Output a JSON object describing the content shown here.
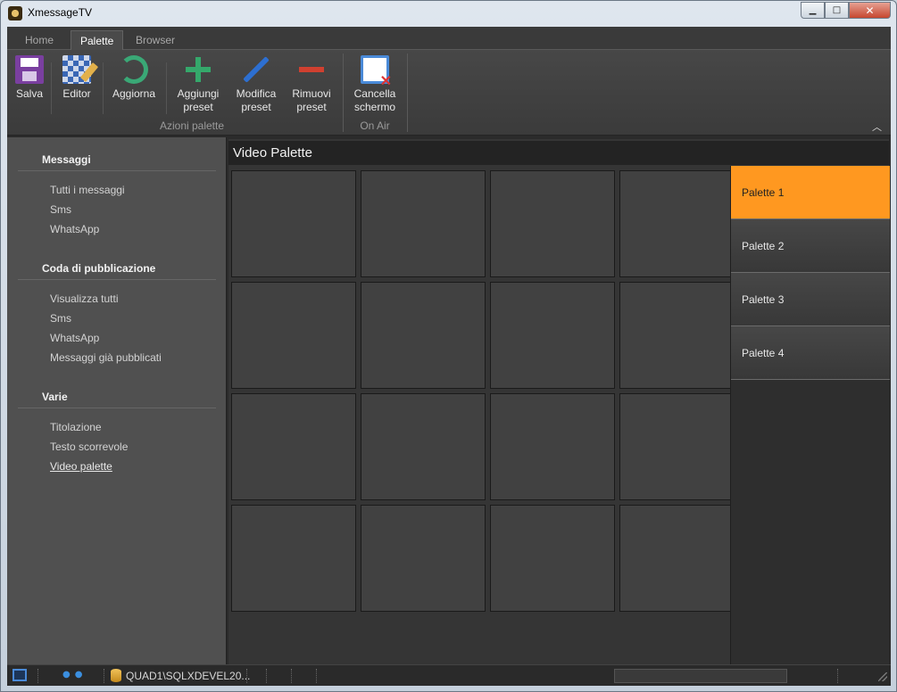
{
  "window": {
    "title": "XmessageTV",
    "minimize_icon": "minimize-icon",
    "maximize_icon": "maximize-icon",
    "close_label": "✕"
  },
  "ribbon": {
    "tabs": [
      {
        "label": "Home",
        "active": false
      },
      {
        "label": "Palette",
        "active": true
      },
      {
        "label": "Browser",
        "active": false
      }
    ],
    "buttons": {
      "save": {
        "label": "Salva",
        "icon": "save-icon"
      },
      "editor": {
        "label": "Editor",
        "icon": "editor-icon"
      },
      "refresh": {
        "label": "Aggiorna",
        "icon": "refresh-icon"
      },
      "add_preset": {
        "label_1": "Aggiungi",
        "label_2": "preset",
        "icon": "plus-icon"
      },
      "edit_preset": {
        "label_1": "Modifica",
        "label_2": "preset",
        "icon": "pencil-icon"
      },
      "remove_preset": {
        "label_1": "Rimuovi",
        "label_2": "preset",
        "icon": "minus-icon"
      },
      "clear_screen": {
        "label_1": "Cancella",
        "label_2": "schermo",
        "icon": "clear-screen-icon"
      }
    },
    "groups": {
      "palette_actions": "Azioni palette",
      "on_air": "On Air"
    },
    "collapse_label": "︿"
  },
  "sidebar": {
    "sections": [
      {
        "title": "Messaggi",
        "items": [
          "Tutti i messaggi",
          "Sms",
          "WhatsApp"
        ]
      },
      {
        "title": "Coda di pubblicazione",
        "items": [
          "Visualizza tutti",
          "Sms",
          "WhatsApp",
          "Messaggi già pubblicati"
        ]
      },
      {
        "title": "Varie",
        "items": [
          "Titolazione",
          "Testo scorrevole",
          "Video palette"
        ]
      }
    ]
  },
  "main": {
    "title": "Video Palette",
    "palettes": [
      "Palette 1",
      "Palette 2",
      "Palette 3",
      "Palette 4"
    ],
    "selected_palette": "Palette 1",
    "accent_color": "#ff9820"
  },
  "statusbar": {
    "connection": "QUAD1\\SQLXDEVEL20..."
  }
}
